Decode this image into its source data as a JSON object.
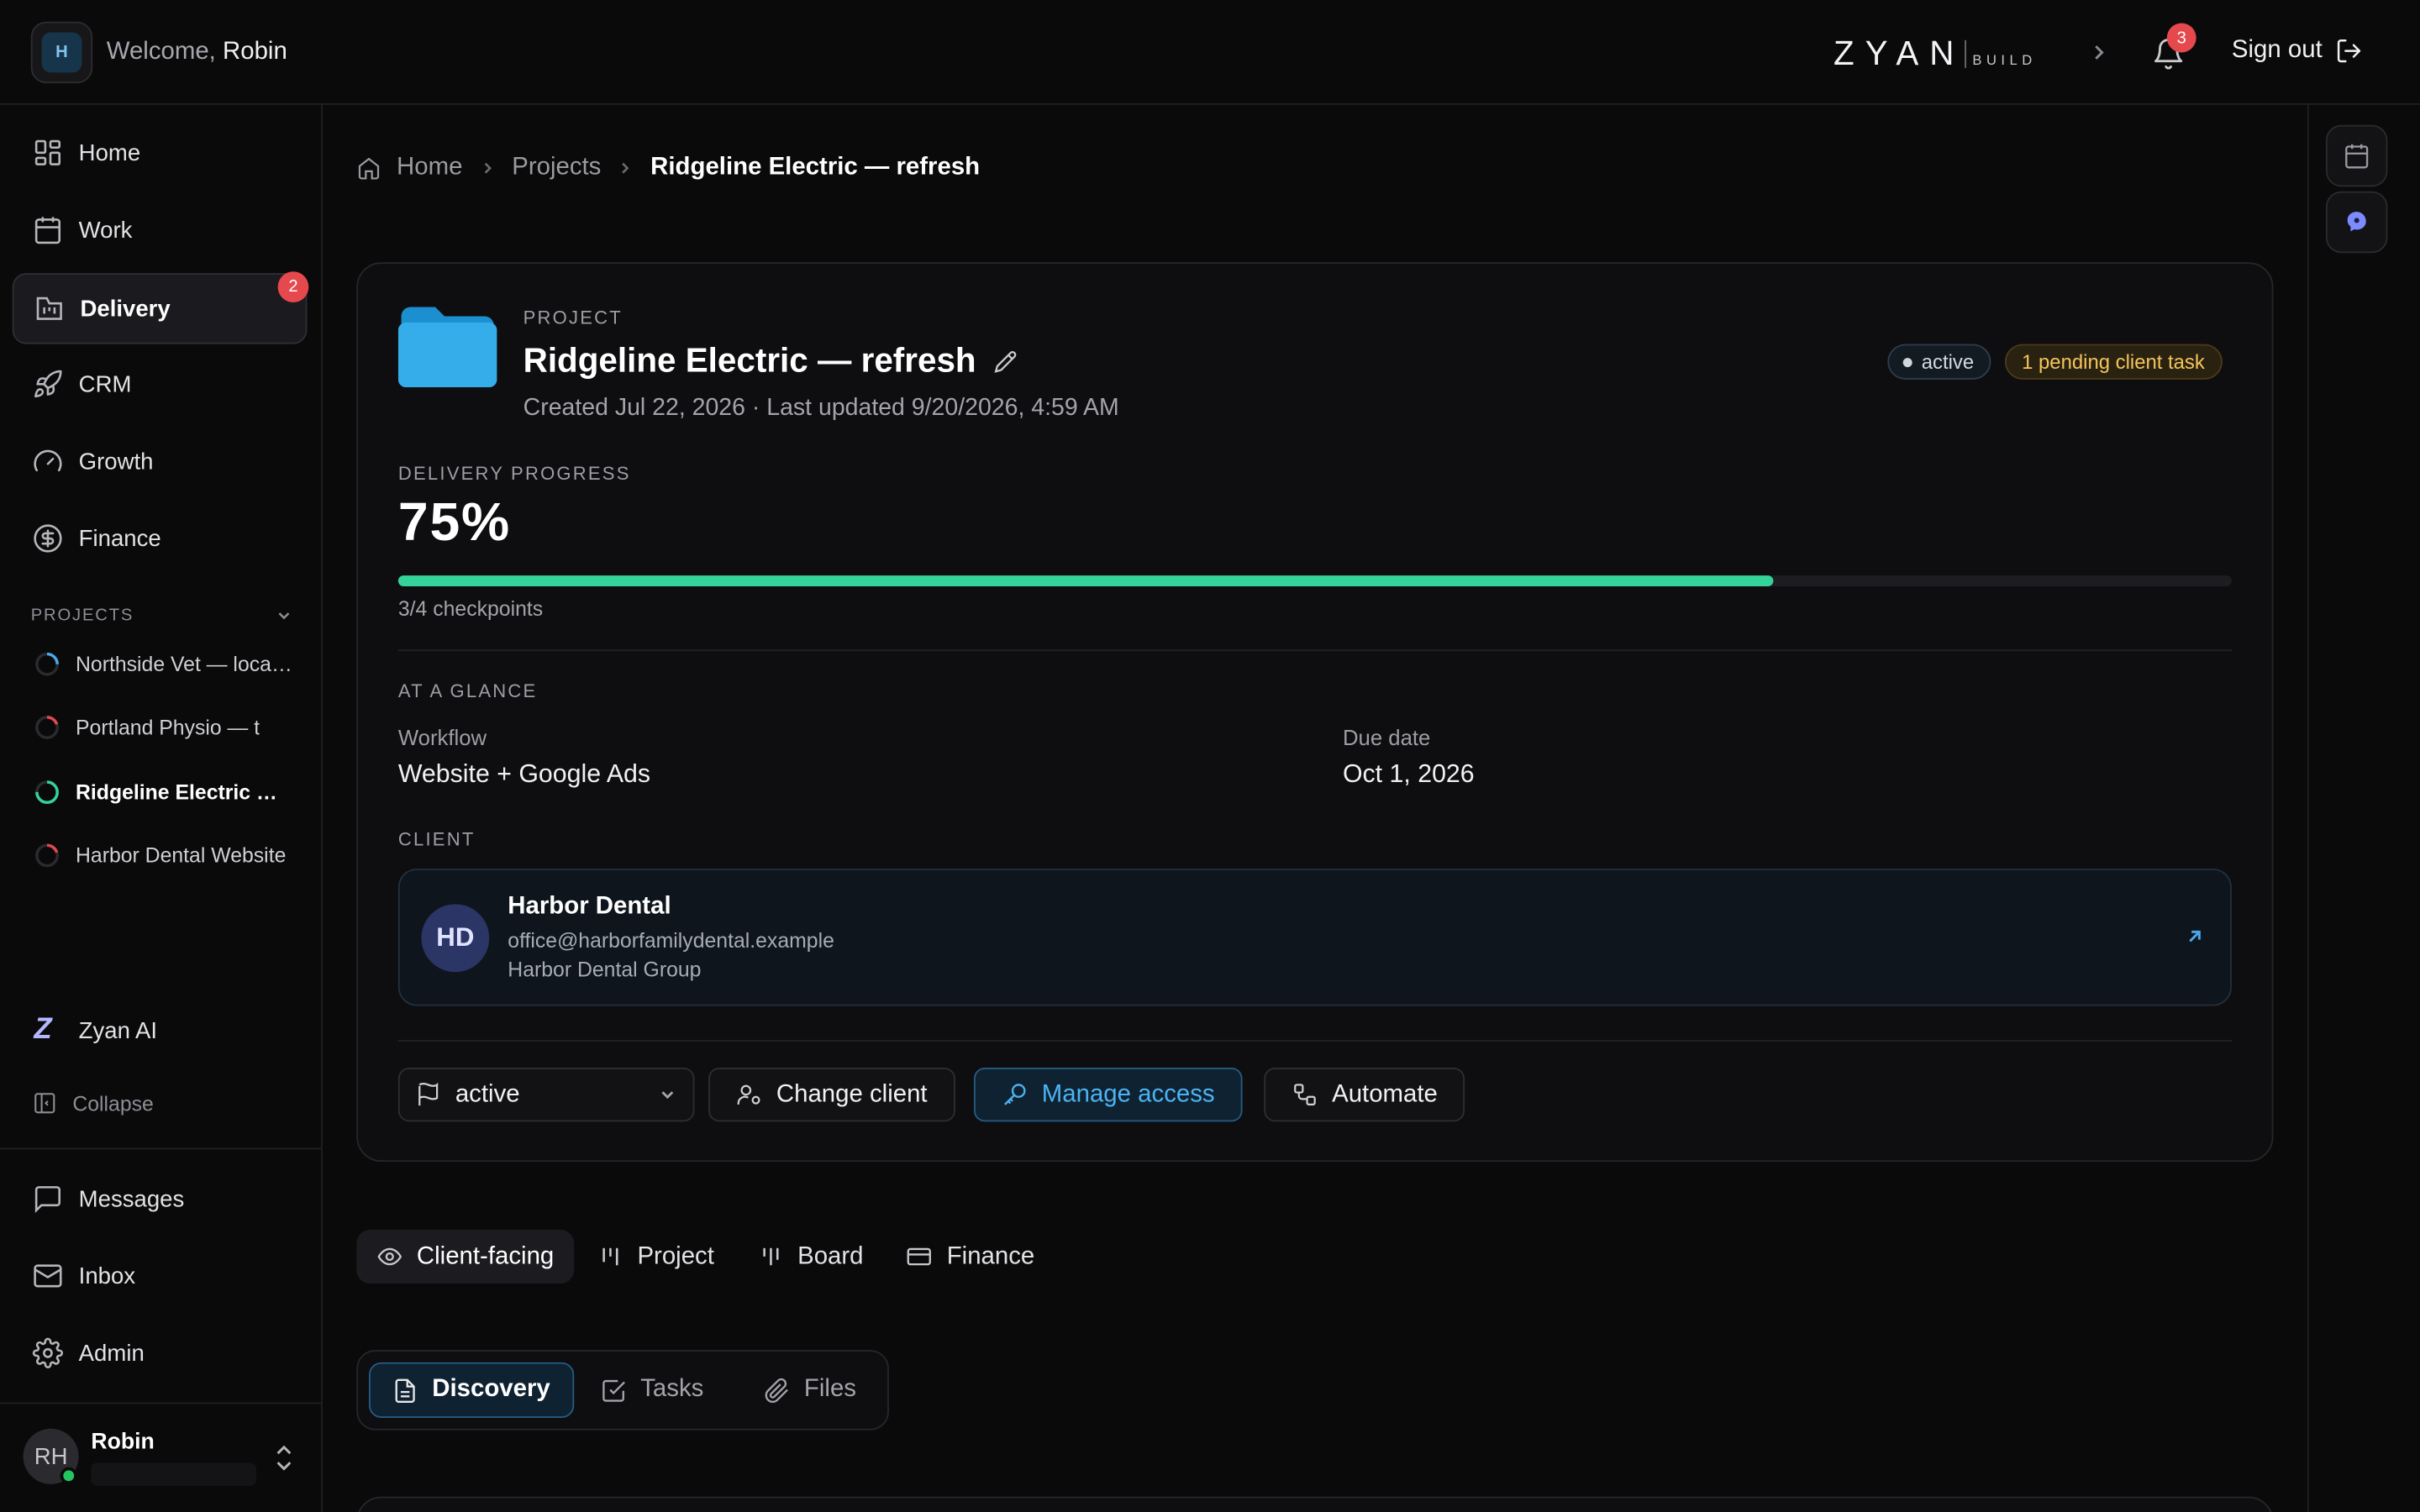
{
  "topbar": {
    "workspace_initial": "H",
    "welcome_prefix": "Welcome, ",
    "welcome_name": "Robin",
    "brand_name": "ZYAN",
    "brand_suffix": "BUILD",
    "notification_count": "3",
    "sign_out_label": "Sign out"
  },
  "sidebar": {
    "nav": [
      {
        "label": "Home",
        "icon": "layout-grid-icon"
      },
      {
        "label": "Work",
        "icon": "calendar-icon"
      },
      {
        "label": "Delivery",
        "icon": "delivery-chart-icon",
        "badge": "2",
        "active": true
      },
      {
        "label": "CRM",
        "icon": "rocket-icon"
      },
      {
        "label": "Growth",
        "icon": "gauge-icon"
      },
      {
        "label": "Finance",
        "icon": "dollar-circle-icon"
      }
    ],
    "projects_heading": "PROJECTS",
    "projects": [
      {
        "label": "Northside Vet — local SEO",
        "progress": 0.25,
        "color": "#4aa8e8"
      },
      {
        "label": "Portland Physio — t",
        "progress": 0.2,
        "color": "#e5484d"
      },
      {
        "label": "Ridgeline Electric — refresh",
        "progress": 0.75,
        "color": "#34d399",
        "current": true
      },
      {
        "label": "Harbor Dental Website",
        "progress": 0.2,
        "color": "#e5484d"
      }
    ],
    "ai_label": "Zyan AI",
    "collapse_label": "Collapse",
    "bottom_nav": [
      {
        "label": "Messages",
        "icon": "message-square-icon"
      },
      {
        "label": "Inbox",
        "icon": "mail-icon"
      },
      {
        "label": "Admin",
        "icon": "gear-icon"
      }
    ],
    "user": {
      "initials": "RH",
      "name": "Robin",
      "status_color": "#22c55e"
    }
  },
  "breadcrumb": {
    "home": "Home",
    "projects": "Projects",
    "current": "Ridgeline Electric — refresh"
  },
  "project": {
    "eyebrow": "PROJECT",
    "title": "Ridgeline Electric — refresh",
    "meta": "Created Jul 22, 2026 · Last updated 9/20/2026, 4:59 AM",
    "status_pill": "active",
    "pending_pill": "1 pending client task",
    "progress_label": "DELIVERY PROGRESS",
    "progress_text": "75%",
    "progress_value": 0.75,
    "checkpoints": "3/4 checkpoints",
    "glance_label": "AT A GLANCE",
    "workflow_label": "Workflow",
    "workflow_value": "Website + Google Ads",
    "due_label": "Due date",
    "due_value": "Oct 1, 2026",
    "client_label": "CLIENT",
    "client": {
      "initials": "HD",
      "name": "Harbor Dental",
      "email": "office@harborfamilydental.example",
      "org": "Harbor Dental Group"
    },
    "actions": {
      "status_select": "active",
      "change_client": "Change client",
      "manage_access": "Manage access",
      "automate": "Automate"
    }
  },
  "tabs": [
    "Client-facing",
    "Project",
    "Board",
    "Finance"
  ],
  "subtabs": [
    "Discovery",
    "Tasks",
    "Files"
  ],
  "colors": {
    "accent": "#4cb3f2",
    "progress": "#34d399",
    "badge": "#e5484d",
    "pending": "#f3c45d"
  }
}
